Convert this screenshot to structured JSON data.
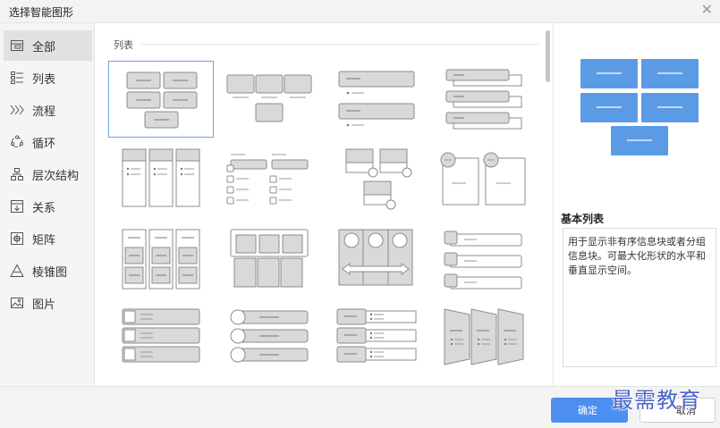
{
  "dialog": {
    "title": "选择智能图形"
  },
  "sidebar": {
    "items": [
      {
        "label": "全部",
        "icon": "all-icon",
        "active": true
      },
      {
        "label": "列表",
        "icon": "list-icon"
      },
      {
        "label": "流程",
        "icon": "process-icon"
      },
      {
        "label": "循环",
        "icon": "cycle-icon"
      },
      {
        "label": "层次结构",
        "icon": "hierarchy-icon"
      },
      {
        "label": "关系",
        "icon": "relationship-icon"
      },
      {
        "label": "矩阵",
        "icon": "matrix-icon"
      },
      {
        "label": "棱锥图",
        "icon": "pyramid-icon"
      },
      {
        "label": "图片",
        "icon": "picture-icon"
      }
    ]
  },
  "content": {
    "section_title": "列表",
    "selected_index": 0
  },
  "preview": {
    "name": "基本列表",
    "description": "用于显示非有序信息块或者分组信息块。可最大化形状的水平和垂直显示空间。"
  },
  "footer": {
    "ok_label": "确定",
    "cancel_label": "取消"
  },
  "watermark": {
    "text": "最需教育"
  },
  "colors": {
    "accent": "#4d8ff0",
    "preview_block": "#5b9be6",
    "thumb_fill": "#d9d9d9",
    "thumb_stroke": "#8c8c8c"
  }
}
